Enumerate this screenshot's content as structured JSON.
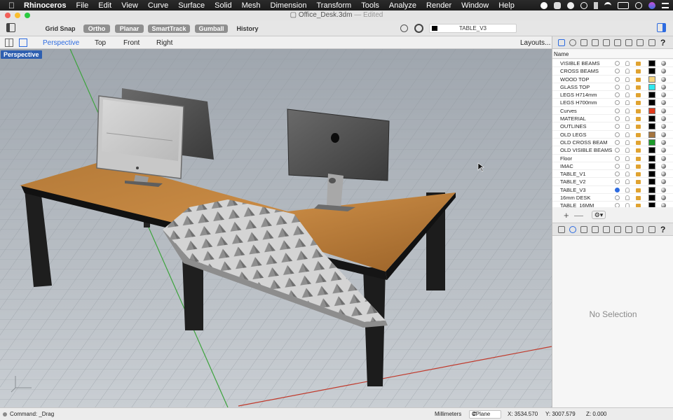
{
  "menubar": {
    "app": "Rhinoceros",
    "items": [
      "File",
      "Edit",
      "View",
      "Curve",
      "Surface",
      "Solid",
      "Mesh",
      "Dimension",
      "Transform",
      "Tools",
      "Analyze",
      "Render",
      "Window",
      "Help"
    ]
  },
  "window": {
    "file": "Office_Desk.3dm",
    "state": "Edited"
  },
  "toolbar": {
    "grid_snap": "Grid Snap",
    "ortho": "Ortho",
    "planar": "Planar",
    "smarttrack": "SmartTrack",
    "gumball": "Gumball",
    "history": "History",
    "current_layer": "TABLE_V3"
  },
  "viewport_tabs": {
    "items": [
      "Perspective",
      "Top",
      "Front",
      "Right"
    ],
    "active": "Perspective",
    "layouts": "Layouts..."
  },
  "viewport": {
    "label": "Perspective"
  },
  "layers": {
    "header": "Name",
    "rows": [
      {
        "name": "VISIBLE BEAMS",
        "color": "#000000",
        "current": false
      },
      {
        "name": "CROSS BEAMS",
        "color": "#000000",
        "current": false
      },
      {
        "name": "WOOD TOP",
        "color": "#f5d27a",
        "current": false
      },
      {
        "name": "GLASS TOP",
        "color": "#2fe8ee",
        "current": false
      },
      {
        "name": "LEGS H714mm",
        "color": "#000000",
        "current": false
      },
      {
        "name": "LEGS H700mm",
        "color": "#000000",
        "current": false
      },
      {
        "name": "Curves",
        "color": "#e23a1c",
        "current": false
      },
      {
        "name": "MATERIAL",
        "color": "#000000",
        "current": false
      },
      {
        "name": "OUTLINES",
        "color": "#000000",
        "current": false
      },
      {
        "name": "OLD LEGS",
        "color": "#a4743f",
        "current": false
      },
      {
        "name": "OLD CROSS BEAM",
        "color": "#1c9b2a",
        "current": false
      },
      {
        "name": "OLD VISIBLE BEAMS",
        "color": "#000000",
        "current": false
      },
      {
        "name": "Floor",
        "color": "#000000",
        "current": false
      },
      {
        "name": "IMAC",
        "color": "#000000",
        "current": false
      },
      {
        "name": "TABLE_V1",
        "color": "#000000",
        "current": false
      },
      {
        "name": "TABLE_V2",
        "color": "#000000",
        "current": false
      },
      {
        "name": "TABLE_V3",
        "color": "#000000",
        "current": true
      },
      {
        "name": "16mm DESK",
        "color": "#000000",
        "current": false
      },
      {
        "name": "TABLE_16MM",
        "color": "#000000",
        "current": false
      }
    ]
  },
  "properties": {
    "empty": "No Selection"
  },
  "status": {
    "command": "Command: _Drag",
    "units": "Millimeters",
    "cplane": "CPlane",
    "x": "X: 3534.570",
    "y": "Y: 3007.579",
    "z": "Z: 0.000"
  }
}
